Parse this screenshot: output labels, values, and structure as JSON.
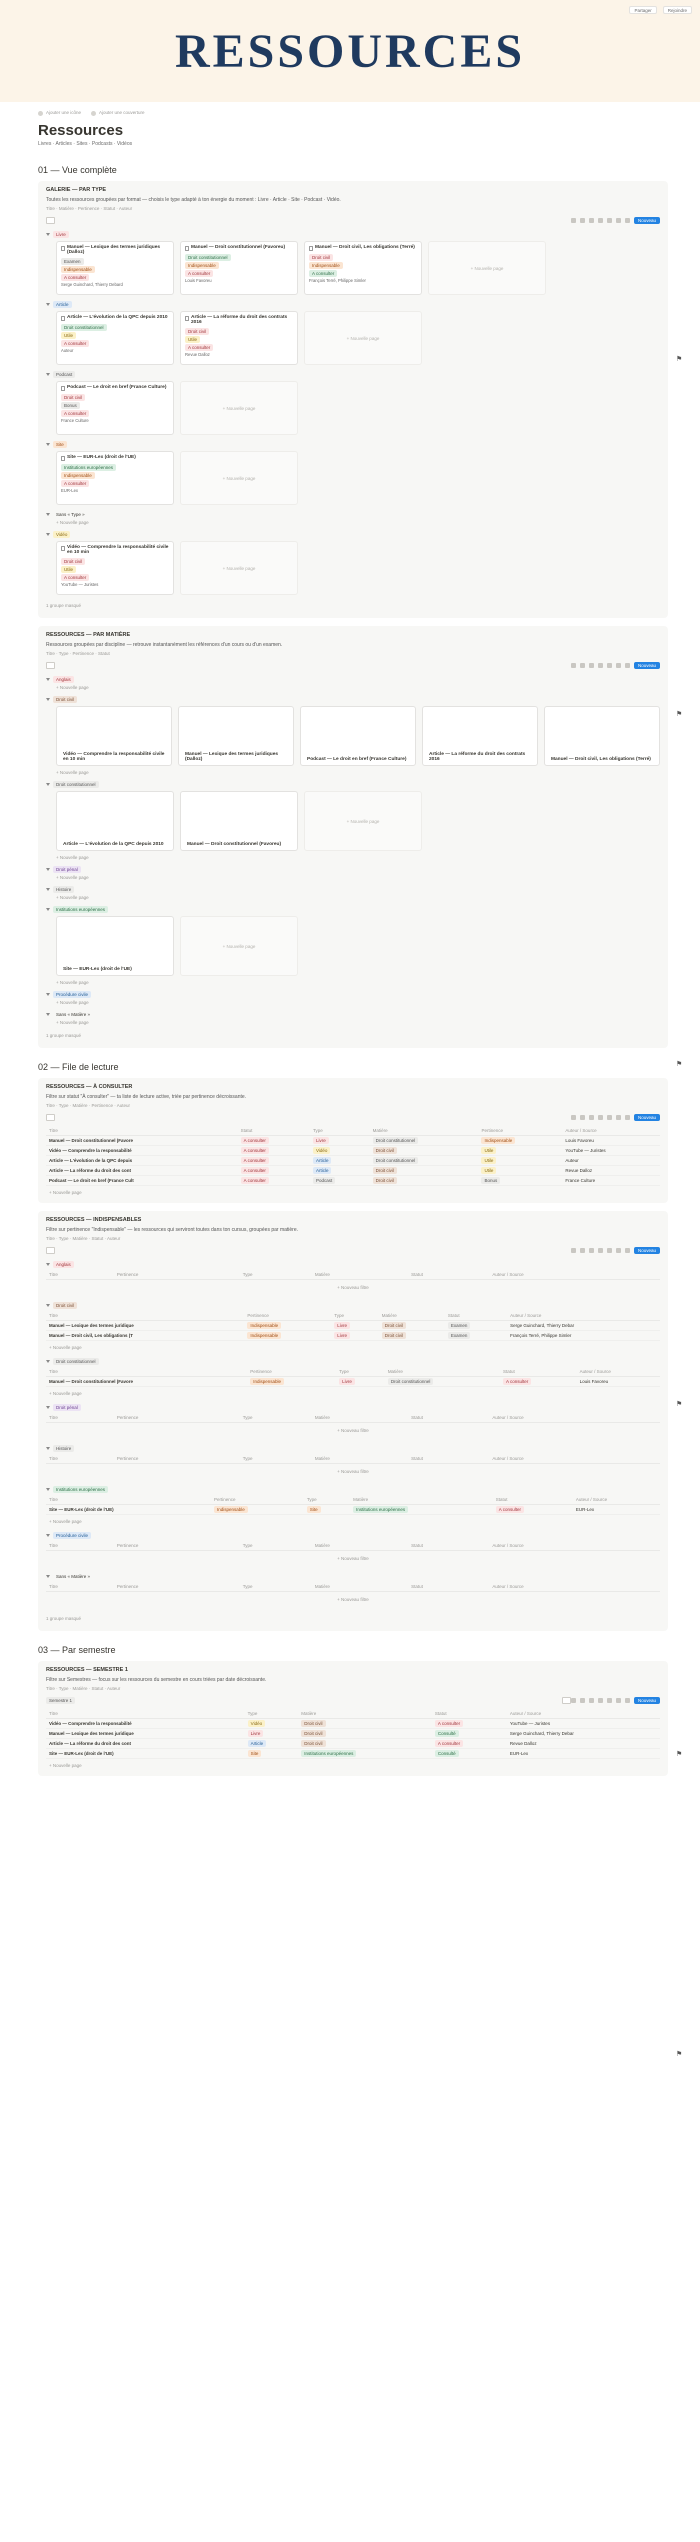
{
  "topbar": {
    "share": "Partager",
    "more": "Rejoindre"
  },
  "hero": {
    "title": "RESSOURCES"
  },
  "crumbs": [
    "Ajouter une icône",
    "Ajouter une couverture"
  ],
  "page": {
    "title": "Ressources",
    "subtitle": "Livres · Articles · Sites · Podcasts · Vidéos"
  },
  "sections": {
    "s1": "01 — Vue complète",
    "s2": "02 — File de lecture",
    "s3": "03 — Par semestre"
  },
  "common": {
    "new": "Nouveau",
    "add": "+ Nouvelle page",
    "hidden": "1 groupe masqué",
    "hidden2": "1 groupe masqué",
    "add_filter": "+ Nouveau filtre",
    "calc": "Calculer"
  },
  "gallery1": {
    "title": "GALERIE — PAR TYPE",
    "desc": "Toutes les ressources groupées par format — choisis le type adapté à ton énergie du moment : Livre · Article · Site · Podcast · Vidéo.",
    "props": "Titre · Matière · Pertinence · Statut · Auteur",
    "groups": [
      {
        "label": "Livre",
        "tag": "t-rose",
        "cards": [
          {
            "title": "Manuel — Lexique des termes juridiques (Dalloz)",
            "tags": [
              [
                "Examen",
                "t-gray"
              ],
              [
                "Indispensable",
                "t-orange"
              ],
              [
                "A consulter",
                "t-rose"
              ]
            ],
            "line": "Serge Guinchard, Thierry Debard"
          },
          {
            "title": "Manuel — Droit constitutionnel (Favoreu)",
            "tags": [
              [
                "Droit constitutionnel",
                "t-green"
              ],
              [
                "Indispensable",
                "t-orange"
              ],
              [
                "A consulter",
                "t-rose"
              ]
            ],
            "line": "Louis Favoreu"
          },
          {
            "title": "Manuel — Droit civil, Les obligations (Terré)",
            "tags": [
              [
                "Droit civil",
                "t-rose"
              ],
              [
                "Indispensable",
                "t-orange"
              ],
              [
                "A consulter",
                "t-green"
              ]
            ],
            "line": "François Terré, Philippe Simler"
          }
        ]
      },
      {
        "label": "Article",
        "tag": "t-blue",
        "cards": [
          {
            "title": "Article — L'évolution de la QPC depuis 2010",
            "tags": [
              [
                "Droit constitutionnel",
                "t-green"
              ],
              [
                "Utile",
                "t-yellow"
              ],
              [
                "A consulter",
                "t-rose"
              ]
            ],
            "line": "Auteur"
          },
          {
            "title": "Article — La réforme du droit des contrats 2016",
            "tags": [
              [
                "Droit civil",
                "t-rose"
              ],
              [
                "Utile",
                "t-yellow"
              ],
              [
                "A consulter",
                "t-rose"
              ]
            ],
            "line": "Revue Dalloz"
          }
        ]
      },
      {
        "label": "Podcast",
        "tag": "t-gray",
        "cards": [
          {
            "title": "Podcast — Le droit en bref (France Culture)",
            "tags": [
              [
                "Droit civil",
                "t-rose"
              ],
              [
                "Bonus",
                "t-gray"
              ],
              [
                "A consulter",
                "t-rose"
              ]
            ],
            "line": "France Culture"
          }
        ]
      },
      {
        "label": "Site",
        "tag": "t-orange",
        "cards": [
          {
            "title": "Site — EUR-Lex (droit de l'UE)",
            "tags": [
              [
                "Institutions européennes",
                "t-green"
              ],
              [
                "Indispensable",
                "t-orange"
              ],
              [
                "A consulter",
                "t-rose"
              ]
            ],
            "line": "EUR-Lex"
          }
        ]
      },
      {
        "label": "Sans « Type »",
        "tag": "",
        "cards": []
      },
      {
        "label": "Vidéo",
        "tag": "t-yellow",
        "cards": [
          {
            "title": "Vidéo — Comprendre la responsabilité civile en 10 min",
            "tags": [
              [
                "Droit civil",
                "t-rose"
              ],
              [
                "Utile",
                "t-yellow"
              ],
              [
                "A consulter",
                "t-rose"
              ]
            ],
            "line": "YouTube — Juristes"
          }
        ]
      }
    ]
  },
  "gallery2": {
    "title": "RESSOURCES — PAR MATIÈRE",
    "desc": "Ressources groupées par discipline — retrouve instantanément les références d'un cours ou d'un examen.",
    "props": "Titre · Type · Pertinence · Statut",
    "groups": [
      {
        "label": "Anglais",
        "tag": "t-rose",
        "cards": []
      },
      {
        "label": "Droit civil",
        "tag": "t-brown",
        "cards": [
          "Vidéo — Comprendre la responsabilité civile en 10 min",
          "Manuel — Lexique des termes juridiques (Dalloz)",
          "Podcast — Le droit en bref (France Culture)",
          "Article — La réforme du droit des contrats 2016",
          "Manuel — Droit civil, Les obligations (Terré)"
        ]
      },
      {
        "label": "Droit constitutionnel",
        "tag": "t-gray",
        "cards": [
          "Article — L'évolution de la QPC depuis 2010",
          "Manuel — Droit constitutionnel (Favoreu)"
        ]
      },
      {
        "label": "Droit pénal",
        "tag": "t-purple",
        "cards": []
      },
      {
        "label": "Histoire",
        "tag": "t-gray",
        "cards": []
      },
      {
        "label": "Institutions européennes",
        "tag": "t-green",
        "cards": [
          "Site — EUR-Lex (droit de l'UE)"
        ]
      },
      {
        "label": "Procédure civile",
        "tag": "t-blue",
        "cards": []
      },
      {
        "label": "Sans « Matière »",
        "tag": "",
        "cards": []
      }
    ]
  },
  "table1": {
    "title": "RESSOURCES — À CONSULTER",
    "desc": "Filtre sur statut \"À consulter\" — ta liste de lecture active, triée par pertinence décroissante.",
    "props": "Titre · Type · Matière · Pertinence · Auteur",
    "cols": [
      "Titre",
      "Statut",
      "Type",
      "Matière",
      "Pertinence",
      "Auteur / Source"
    ],
    "rows": [
      [
        [
          "Manuel — Droit constitutionnel (Favore",
          ""
        ],
        [
          "A consulter",
          "t-rose"
        ],
        [
          "Livre",
          "t-rose"
        ],
        [
          "Droit constitutionnel",
          "t-gray"
        ],
        [
          "Indispensable",
          "t-orange"
        ],
        [
          "Louis Favoreu",
          ""
        ]
      ],
      [
        [
          "Vidéo — Comprendre la responsabilité",
          ""
        ],
        [
          "A consulter",
          "t-rose"
        ],
        [
          "Vidéo",
          "t-yellow"
        ],
        [
          "Droit civil",
          "t-brown"
        ],
        [
          "Utile",
          "t-yellow"
        ],
        [
          "YouTube — Juristes",
          ""
        ]
      ],
      [
        [
          "Article — L'évolution de la QPC depuis",
          ""
        ],
        [
          "A consulter",
          "t-rose"
        ],
        [
          "Article",
          "t-blue"
        ],
        [
          "Droit constitutionnel",
          "t-gray"
        ],
        [
          "Utile",
          "t-yellow"
        ],
        [
          "Auteur",
          ""
        ]
      ],
      [
        [
          "Article — La réforme du droit des cont",
          ""
        ],
        [
          "A consulter",
          "t-rose"
        ],
        [
          "Article",
          "t-blue"
        ],
        [
          "Droit civil",
          "t-brown"
        ],
        [
          "Utile",
          "t-yellow"
        ],
        [
          "Revue Dalloz",
          ""
        ]
      ],
      [
        [
          "Podcast — Le droit en bref (France Cult",
          ""
        ],
        [
          "A consulter",
          "t-rose"
        ],
        [
          "Podcast",
          "t-gray"
        ],
        [
          "Droit civil",
          "t-brown"
        ],
        [
          "Bonus",
          "t-gray"
        ],
        [
          "France Culture",
          ""
        ]
      ]
    ]
  },
  "table2": {
    "title": "RESSOURCES — INDISPENSABLES",
    "desc": "Filtre sur pertinence \"Indispensable\" — les ressources qui serviront toutes dans ton cursus, groupées par matière.",
    "props": "Titre · Type · Matière · Statut · Auteur",
    "cols": [
      "Titre",
      "Pertinence",
      "Type",
      "Matière",
      "Statut",
      "Auteur / Source"
    ],
    "groups": [
      {
        "label": "Anglais",
        "tag": "t-rose",
        "rows": []
      },
      {
        "label": "Droit civil",
        "tag": "t-brown",
        "rows": [
          [
            [
              "Manuel — Lexique des termes juridique",
              ""
            ],
            [
              "Indispensable",
              "t-orange"
            ],
            [
              "Livre",
              "t-rose"
            ],
            [
              "Droit civil",
              "t-brown"
            ],
            [
              "Examen",
              "t-gray"
            ],
            [
              "Serge Guinchard, Thierry Debar",
              ""
            ]
          ],
          [
            [
              "Manuel — Droit civil, Les obligations (T",
              ""
            ],
            [
              "Indispensable",
              "t-orange"
            ],
            [
              "Livre",
              "t-rose"
            ],
            [
              "Droit civil",
              "t-brown"
            ],
            [
              "Examen",
              "t-gray"
            ],
            [
              "François Terré, Philippe Simler",
              ""
            ]
          ]
        ]
      },
      {
        "label": "Droit constitutionnel",
        "tag": "t-gray",
        "rows": [
          [
            [
              "Manuel — Droit constitutionnel (Favore",
              ""
            ],
            [
              "Indispensable",
              "t-orange"
            ],
            [
              "Livre",
              "t-rose"
            ],
            [
              "Droit constitutionnel",
              "t-gray"
            ],
            [
              "A consulter",
              "t-rose"
            ],
            [
              "Louis Favoreu",
              ""
            ]
          ]
        ]
      },
      {
        "label": "Droit pénal",
        "tag": "t-purple",
        "rows": []
      },
      {
        "label": "Histoire",
        "tag": "t-gray",
        "rows": []
      },
      {
        "label": "Institutions européennes",
        "tag": "t-green",
        "rows": [
          [
            [
              "Site — EUR-Lex (droit de l'UE)",
              ""
            ],
            [
              "Indispensable",
              "t-orange"
            ],
            [
              "Site",
              "t-orange"
            ],
            [
              "Institutions européennes",
              "t-green"
            ],
            [
              "A consulter",
              "t-rose"
            ],
            [
              "EUR-Lex",
              ""
            ]
          ]
        ]
      },
      {
        "label": "Procédure civile",
        "tag": "t-blue",
        "rows": []
      },
      {
        "label": "Sans « Matière »",
        "tag": "",
        "rows": []
      }
    ]
  },
  "table3": {
    "title": "RESSOURCES — SEMESTRE 1",
    "desc": "Filtre sur Semestres — focus sur les ressources du semestre en cours triées par date décroissante.",
    "props": "Titre · Type · Matière · Statut · Auteur",
    "tab": "Semestre 1",
    "cols": [
      "Titre",
      "Type",
      "Matière",
      "Statut",
      "Auteur / Source"
    ],
    "rows": [
      [
        [
          "Vidéo — Comprendre la responsabilité",
          ""
        ],
        [
          "Vidéo",
          "t-yellow"
        ],
        [
          "Droit civil",
          "t-brown"
        ],
        [
          "A consulter",
          "t-rose"
        ],
        [
          "YouTube — Juristes",
          ""
        ]
      ],
      [
        [
          "Manuel — Lexique des termes juridique",
          ""
        ],
        [
          "Livre",
          "t-rose"
        ],
        [
          "Droit civil",
          "t-brown"
        ],
        [
          "Consulté",
          "t-green"
        ],
        [
          "Serge Guinchard, Thierry Debar",
          ""
        ]
      ],
      [
        [
          "Article — La réforme du droit des cont",
          ""
        ],
        [
          "Article",
          "t-blue"
        ],
        [
          "Droit civil",
          "t-brown"
        ],
        [
          "A consulter",
          "t-rose"
        ],
        [
          "Revue Dalloz",
          ""
        ]
      ],
      [
        [
          "Site — EUR-Lex (droit de l'UE)",
          ""
        ],
        [
          "Site",
          "t-orange"
        ],
        [
          "Institutions européennes",
          "t-green"
        ],
        [
          "Consulté",
          "t-green"
        ],
        [
          "EUR-Lex",
          ""
        ]
      ]
    ]
  }
}
